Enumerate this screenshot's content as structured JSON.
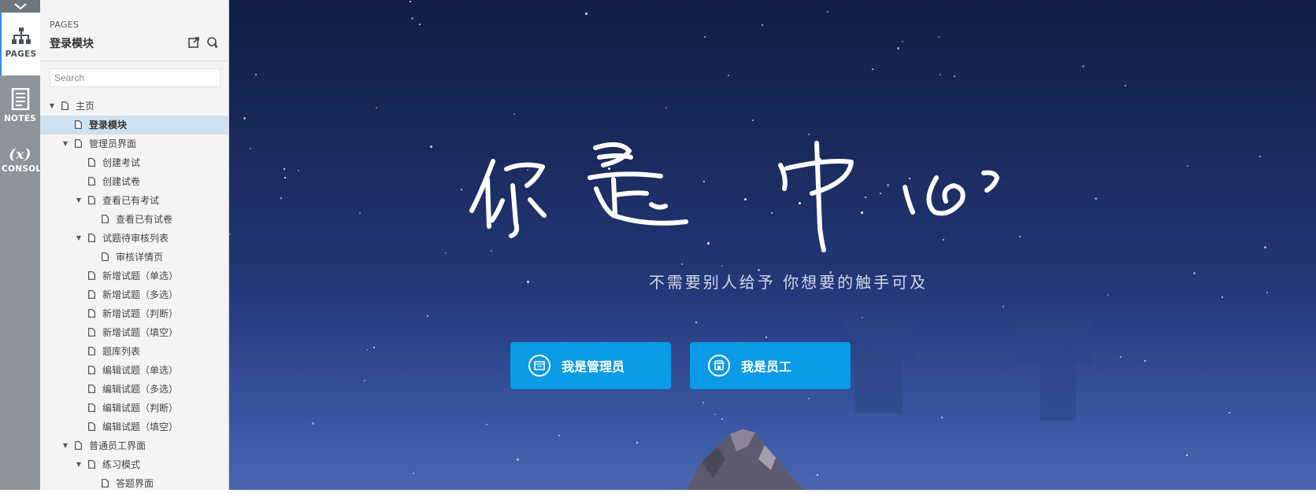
{
  "rail": {
    "tabs": [
      {
        "label": "PAGES",
        "icon": "sitemap-icon"
      },
      {
        "label": "NOTES",
        "icon": "notes-icon"
      },
      {
        "label": "CONSOLE",
        "icon": "variable-icon",
        "symbol": "(x)"
      }
    ]
  },
  "panel": {
    "header": "PAGES",
    "title": "登录模块",
    "search_placeholder": "Search",
    "tree": [
      {
        "label": "主页",
        "depth": 0,
        "expanded": true,
        "selected": false
      },
      {
        "label": "登录模块",
        "depth": 1,
        "selected": true
      },
      {
        "label": "管理员界面",
        "depth": 1,
        "expanded": true,
        "selected": false
      },
      {
        "label": "创建考试",
        "depth": 2,
        "selected": false
      },
      {
        "label": "创建试卷",
        "depth": 2,
        "selected": false
      },
      {
        "label": "查看已有考试",
        "depth": 2,
        "expanded": true,
        "selected": false
      },
      {
        "label": "查看已有试卷",
        "depth": 3,
        "selected": false
      },
      {
        "label": "试题待审核列表",
        "depth": 2,
        "expanded": true,
        "selected": false
      },
      {
        "label": "审核详情页",
        "depth": 3,
        "selected": false
      },
      {
        "label": "新增试题（单选）",
        "depth": 2,
        "selected": false
      },
      {
        "label": "新增试题（多选）",
        "depth": 2,
        "selected": false
      },
      {
        "label": "新增试题（判断）",
        "depth": 2,
        "selected": false
      },
      {
        "label": "新增试题（填空）",
        "depth": 2,
        "selected": false
      },
      {
        "label": "题库列表",
        "depth": 2,
        "selected": false
      },
      {
        "label": "编辑试题（单选）",
        "depth": 2,
        "selected": false
      },
      {
        "label": "编辑试题（多选）",
        "depth": 2,
        "selected": false
      },
      {
        "label": "编辑试题（判断）",
        "depth": 2,
        "selected": false
      },
      {
        "label": "编辑试题（填空）",
        "depth": 2,
        "selected": false
      },
      {
        "label": "普通员工界面",
        "depth": 1,
        "expanded": true,
        "selected": false
      },
      {
        "label": "练习模式",
        "depth": 2,
        "expanded": true,
        "selected": false
      },
      {
        "label": "答题界面",
        "depth": 3,
        "selected": false
      }
    ]
  },
  "canvas": {
    "headline_calligraphy": "你是中心",
    "subtitle": "不需要别人给予  你想要的触手可及",
    "buttons": [
      {
        "label": "我是管理员",
        "icon": "dashboard-icon"
      },
      {
        "label": "我是员工",
        "icon": "store-icon"
      }
    ],
    "colors": {
      "button": "#0a9ae6",
      "sky_top": "#121e48",
      "sky_bottom": "#4a66b0",
      "selection": "#cfe1ef"
    }
  }
}
